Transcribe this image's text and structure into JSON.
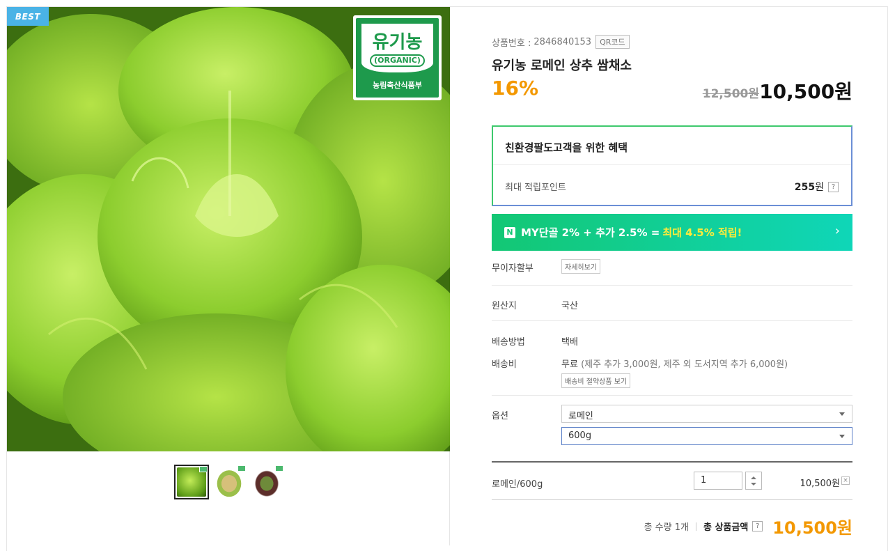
{
  "badges": {
    "best": "BEST"
  },
  "organic_mark": {
    "title": "유기농",
    "sub": "(ORGANIC)",
    "foot": "농림축산식품부"
  },
  "product": {
    "number_label": "상품번호 :",
    "number": "2846840153",
    "qr_label": "QR코드",
    "title": "유기농 로메인 상추 쌈채소",
    "discount": "16%",
    "original_price": "12,500원",
    "price": "10,500원"
  },
  "benefit": {
    "title": "친환경팔도고객을 위한 혜택",
    "point_label": "최대 적립포인트",
    "point_value": "255",
    "point_unit": "원",
    "help": "?"
  },
  "my_bar": {
    "icon": "N",
    "text": "MY단골 2% + 추가 2.5% =",
    "highlight": "최대 4.5% 적립!",
    "arrow": "›"
  },
  "rows": {
    "installment_label": "무이자할부",
    "installment_btn": "자세히보기",
    "origin_label": "원산지",
    "origin_value": "국산",
    "ship_method_label": "배송방법",
    "ship_method_value": "택배",
    "ship_fee_label": "배송비",
    "ship_fee_value": "무료",
    "ship_fee_note": "(제주 추가 3,000원, 제주 외 도서지역 추가 6,000원)",
    "ship_bundle_btn": "배송비 절약상품 보기",
    "option_label": "옵션"
  },
  "options": {
    "option1": "로메인",
    "option2": "600g"
  },
  "order_line": {
    "name": "로메인/600g",
    "qty": "1",
    "price": "10,500원",
    "remove": "×"
  },
  "total": {
    "qty_text": "총 수량 1개",
    "label": "총 상품금액",
    "help": "?",
    "price": "10,500원"
  },
  "colors": {
    "accent": "#f39800",
    "green": "#13c774",
    "organic": "#1e9a4c"
  },
  "icons": {
    "help": "help-icon",
    "close": "close-icon",
    "chevron": "chevron-right-icon"
  }
}
